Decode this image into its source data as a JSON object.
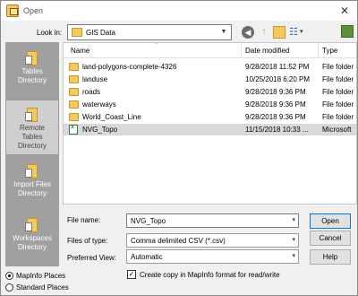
{
  "window": {
    "title": "Open",
    "close_glyph": "✕"
  },
  "lookin": {
    "label": "Look in:",
    "value": "GIS Data"
  },
  "toolbar": {
    "back": "◀",
    "up": "↑",
    "views": "☷",
    "views_caret": "▾",
    "dropdown": "▼"
  },
  "places": [
    {
      "label1": "Tables",
      "label2": "Directory",
      "selected": false
    },
    {
      "label1": "Remote",
      "label2": "Tables",
      "label3": "Directory",
      "selected": true
    },
    {
      "label1": "Import Files",
      "label2": "Directory",
      "selected": false
    },
    {
      "label1": "Workspaces",
      "label2": "Directory",
      "selected": false
    }
  ],
  "filelist": {
    "columns": {
      "name": "Name",
      "date": "Date modified",
      "type": "Type"
    },
    "sort_caret": "^",
    "rows": [
      {
        "name": "land-polygons-complete-4326",
        "date": "9/28/2018 11:52 PM",
        "type": "File folder",
        "icon": "folder-icon"
      },
      {
        "name": "landuse",
        "date": "10/25/2018 6:20 PM",
        "type": "File folder",
        "icon": "folder-icon"
      },
      {
        "name": "roads",
        "date": "9/28/2018 9:36 PM",
        "type": "File folder",
        "icon": "folder-icon"
      },
      {
        "name": "waterways",
        "date": "9/28/2018 9:36 PM",
        "type": "File folder",
        "icon": "folder-icon"
      },
      {
        "name": "World_Coast_Line",
        "date": "9/28/2018 9:36 PM",
        "type": "File folder",
        "icon": "folder-icon"
      },
      {
        "name": "NVG_Topo",
        "date": "11/15/2018 10:33 ...",
        "type": "Microsoft",
        "icon": "csv-file-icon",
        "selected": true
      }
    ]
  },
  "form": {
    "filename_label": "File name:",
    "filename_value": "NVG_Topo",
    "filetype_label": "Files of type:",
    "filetype_value": "Comma delimited CSV (*.csv)",
    "view_label": "Preferred View:",
    "view_value": "Automatic",
    "checkbox_label": "Create copy in MapInfo format for read/write",
    "checkbox_checked": true,
    "check_glyph": "✓",
    "arrow": "▾"
  },
  "buttons": {
    "open": "Open",
    "cancel": "Cancel",
    "help": "Help"
  },
  "radios": [
    {
      "label": "MapInfo Places",
      "checked": true
    },
    {
      "label": "Standard Places",
      "checked": false
    }
  ]
}
